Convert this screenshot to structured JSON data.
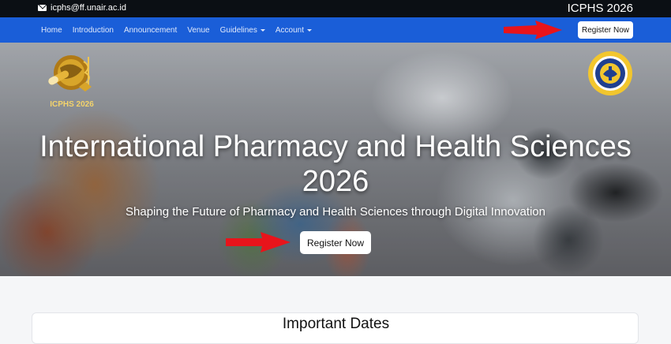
{
  "topbar": {
    "email": "icphs@ff.unair.ac.id",
    "email_icon": "envelope-icon",
    "brand": "ICPHS 2026"
  },
  "nav": {
    "items": [
      {
        "label": "Home",
        "dropdown": false
      },
      {
        "label": "Introduction",
        "dropdown": false
      },
      {
        "label": "Announcement",
        "dropdown": false
      },
      {
        "label": "Venue",
        "dropdown": false
      },
      {
        "label": "Guidelines",
        "dropdown": true
      },
      {
        "label": "Account",
        "dropdown": true
      }
    ],
    "register_label": "Register Now",
    "background_color": "#1a5ed8"
  },
  "hero": {
    "logo_text": "ICPHS 2026",
    "title_line1": "International Pharmacy and Health Sciences",
    "title_line2": "2026",
    "subtitle": "Shaping the Future of Pharmacy and Health Sciences through Digital Innovation",
    "register_label": "Register Now"
  },
  "annotations": {
    "arrow_color": "#e8141b"
  },
  "content": {
    "card_title": "Important Dates"
  }
}
